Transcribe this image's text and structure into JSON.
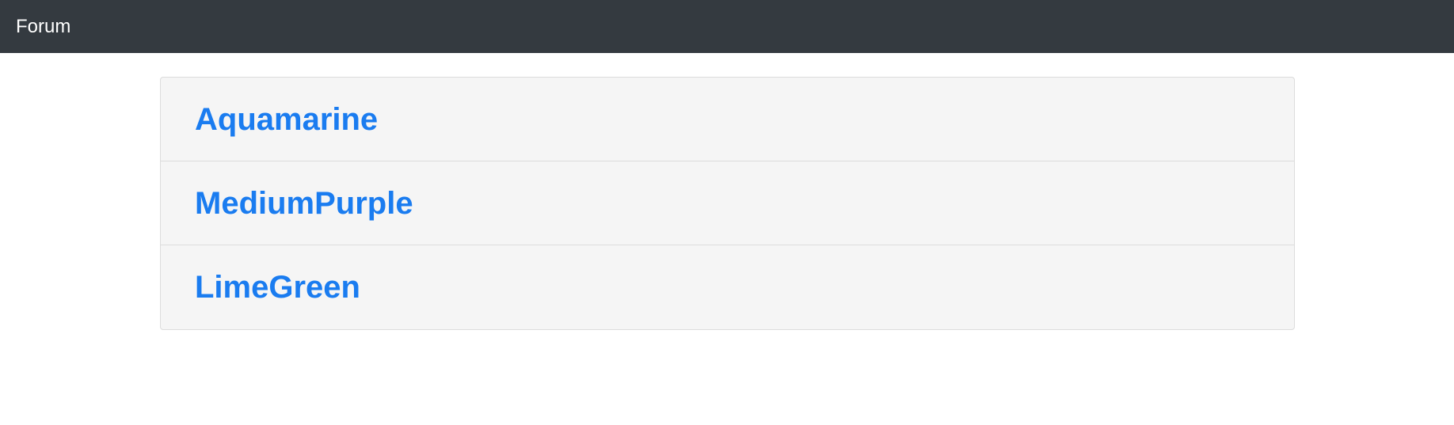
{
  "navbar": {
    "brand": "Forum",
    "background_color": "#343a40",
    "text_color": "#ffffff"
  },
  "forums": {
    "link_color": "#1a7cf0",
    "items": [
      {
        "label": "Aquamarine"
      },
      {
        "label": "MediumPurple"
      },
      {
        "label": "LimeGreen"
      }
    ]
  }
}
